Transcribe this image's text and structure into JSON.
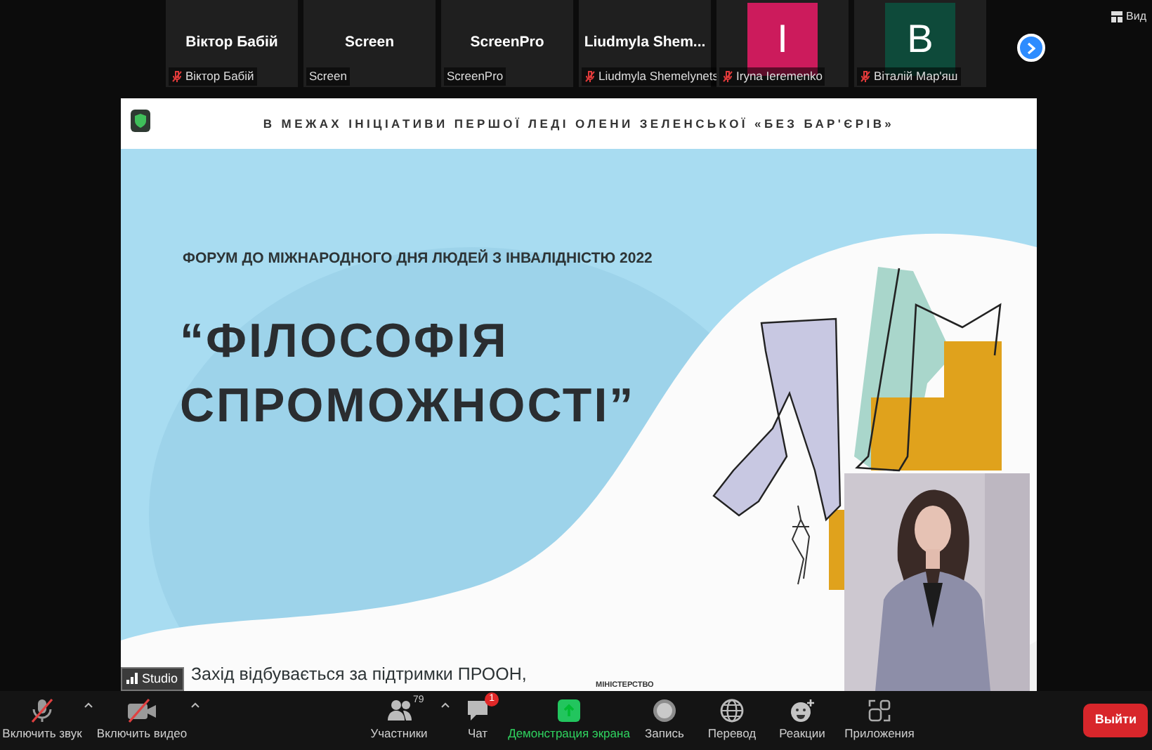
{
  "participants": [
    {
      "kind": "name",
      "display_name": "Віктор Бабій",
      "label": "Віктор Бабій",
      "muted": true
    },
    {
      "kind": "name",
      "display_name": "Screen",
      "label": "Screen",
      "muted": false
    },
    {
      "kind": "name",
      "display_name": "ScreenPro",
      "label": "ScreenPro",
      "muted": false
    },
    {
      "kind": "name",
      "display_name": "Liudmyla  Shem...",
      "label": "Liudmyla Shemelynets",
      "muted": true
    },
    {
      "kind": "avatar",
      "initial": "I",
      "color": "#cc1b5c",
      "label": "Iryna Ieremenko",
      "muted": true
    },
    {
      "kind": "avatar",
      "initial": "B",
      "color": "#0e4a3a",
      "label": "Віталій Мар'яш",
      "muted": true
    }
  ],
  "view_button": "Вид",
  "slide": {
    "header": "В МЕЖАХ ІНІЦІАТИВИ ПЕРШОЇ ЛЕДІ ОЛЕНИ ЗЕЛЕНСЬКОЇ «БЕЗ БАР'ЄРІВ»",
    "subtitle": "ФОРУМ ДО МІЖНАРОДНОГО ДНЯ ЛЮДЕЙ З ІНВАЛІДНІСТЮ 2022",
    "title_lines": [
      "“ФІЛОСОФІЯ",
      "СПРОМОЖНОСТІ”"
    ],
    "footer": "Захід відбувається за підтримки ПРООН,",
    "logo_text": "МІНІСТЕРСТВО"
  },
  "studio_badge": "Studio",
  "toolbar": {
    "items": [
      {
        "kind": "mic",
        "label": "Включить звук",
        "off": true,
        "caret": true,
        "active": false
      },
      {
        "kind": "video",
        "label": "Включить видео",
        "off": true,
        "caret": true,
        "active": false
      },
      {
        "kind": "participants",
        "label": "Участники",
        "count": "79",
        "caret": true,
        "active": false
      },
      {
        "kind": "chat",
        "label": "Чат",
        "badge": "1",
        "caret": false,
        "active": false
      },
      {
        "kind": "share",
        "label": "Демонстрация экрана",
        "caret": false,
        "active": true
      },
      {
        "kind": "record",
        "label": "Запись",
        "caret": false,
        "active": false
      },
      {
        "kind": "translate",
        "label": "Перевод",
        "caret": false,
        "active": false
      },
      {
        "kind": "reactions",
        "label": "Реакции",
        "caret": false,
        "active": false
      },
      {
        "kind": "apps",
        "label": "Приложения",
        "caret": false,
        "active": false
      }
    ],
    "leave_button": "Выйти"
  }
}
